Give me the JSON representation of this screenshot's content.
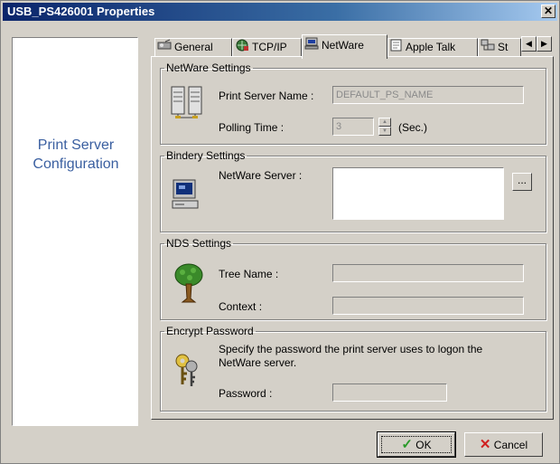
{
  "window": {
    "title": "USB_PS426001 Properties",
    "close_label": "✕"
  },
  "left_panel": {
    "title": "Print Server Configuration"
  },
  "tabs": [
    {
      "label": "General",
      "icon": "general-icon",
      "active": false
    },
    {
      "label": "TCP/IP",
      "icon": "tcpip-icon",
      "active": false
    },
    {
      "label": "NetWare",
      "icon": "netware-icon",
      "active": true
    },
    {
      "label": "Apple Talk",
      "icon": "appletalk-icon",
      "active": false
    },
    {
      "label": "St",
      "icon": "snmp-icon",
      "active": false
    }
  ],
  "tab_scroll": {
    "left": "◀",
    "right": "▶"
  },
  "netware_settings": {
    "legend": "NetWare Settings",
    "print_server_name_label": "Print Server Name :",
    "print_server_name_value": "DEFAULT_PS_NAME",
    "polling_time_label": "Polling Time :",
    "polling_time_value": "3",
    "polling_time_unit": "(Sec.)"
  },
  "bindery_settings": {
    "legend": "Bindery Settings",
    "netware_server_label": "NetWare Server :",
    "browse_label": "..."
  },
  "nds_settings": {
    "legend": "NDS Settings",
    "tree_name_label": "Tree Name :",
    "context_label": "Context :"
  },
  "encrypt_password": {
    "legend": "Encrypt Password",
    "description_line1": "Specify the password the print server uses to logon the",
    "description_line2": "NetWare server.",
    "password_label": "Password :"
  },
  "buttons": {
    "ok": "OK",
    "cancel": "Cancel"
  },
  "colors": {
    "titlebar": "#0a246a",
    "face": "#d4d0c8",
    "left_label": "#3a5fa0"
  }
}
